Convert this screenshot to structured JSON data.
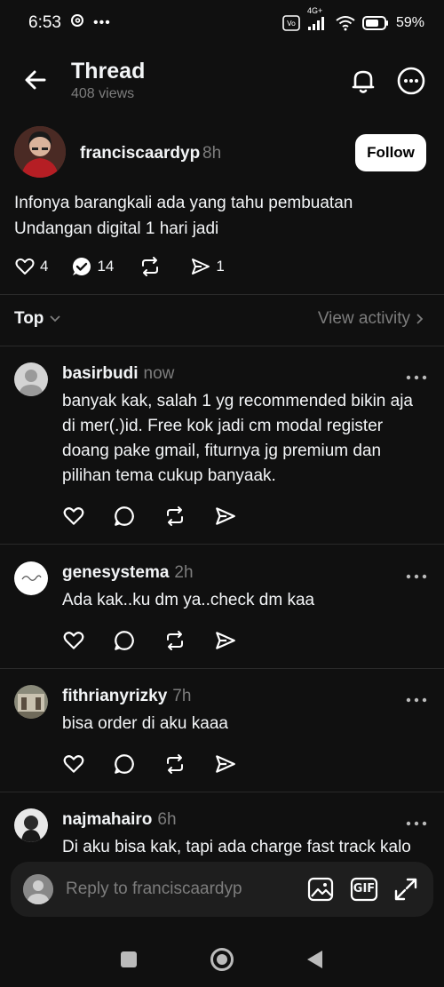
{
  "status_bar": {
    "time": "6:53",
    "battery": "59%",
    "network": "4G+"
  },
  "header": {
    "title": "Thread",
    "views": "408 views",
    "icons": [
      "back-arrow-icon",
      "bell-icon",
      "more-circle-icon"
    ]
  },
  "post": {
    "username": "franciscaardyp",
    "time": "8h",
    "follow_label": "Follow",
    "text_line1": "Infonya barangkali ada yang tahu pembuatan",
    "text_line2": "Undangan digital 1 hari jadi",
    "likes": "4",
    "replies": "14",
    "shares": "1"
  },
  "sort": {
    "label": "Top",
    "view_activity": "View activity"
  },
  "replies": [
    {
      "username": "basirbudi",
      "time": "now",
      "lines": [
        "banyak kak, salah 1 yg recommended bikin aja",
        "di mer(.)id. Free kok jadi cm modal register",
        "doang pake gmail, fiturnya jg premium dan",
        "pilihan tema cukup banyaak."
      ]
    },
    {
      "username": "genesystema",
      "time": "2h",
      "lines": [
        "Ada kak..ku dm ya..check dm kaa"
      ]
    },
    {
      "username": "fithrianyrizky",
      "time": "7h",
      "lines": [
        "bisa order di aku kaaa"
      ]
    },
    {
      "username": "najmahairo",
      "time": "6h",
      "lines": [
        "Di aku bisa kak, tapi ada charge fast track kalo"
      ]
    }
  ],
  "reply_bar": {
    "placeholder": "Reply to franciscaardyp",
    "gif_label": "GIF"
  },
  "colors": {
    "background": "#101010",
    "text": "#f3f5f7",
    "muted": "#7d7d7d",
    "divider": "#2a2a2a"
  }
}
